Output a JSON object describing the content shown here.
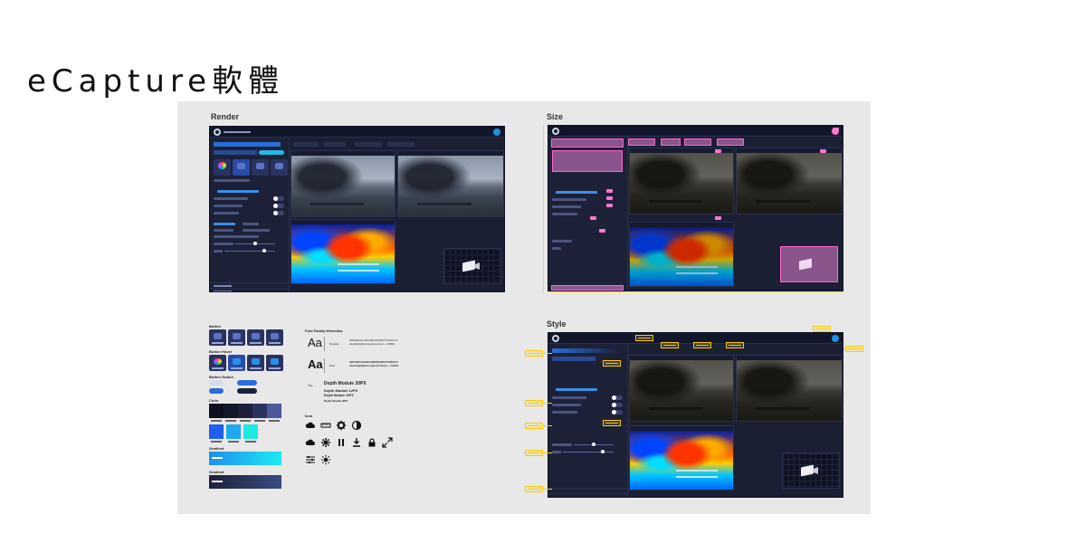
{
  "page": {
    "title": "eCapture軟體"
  },
  "sections": {
    "render": "Render",
    "size": "Size",
    "style": "Style"
  },
  "style_guide": {
    "button_label": "Button",
    "button_hover_label": "Button Hover",
    "button_switch_label": "Button Switch",
    "color_label": "Color",
    "gradient_label": "Gradient",
    "gradient_label_2": "Gradient",
    "font_family": "Font Family:Helvetica",
    "font_aa": "Aa",
    "font_sample_1_weight": "Regular",
    "font_sample_2_weight": "Bold",
    "font_alphabet": "ABCDEFGHIJKLMNOPQRSTUVWXYZ abcdefghijklmnopqrstuvwxyz +-%#$%",
    "type_title_prefix": "Title",
    "type_title": "Depth Module 20PX",
    "type_line_2": "Depth Module 12PX",
    "type_line_3": "Depth Module 10PX",
    "type_line_4": "Depth Module 8PX",
    "icon_label": "Icon",
    "colors": [
      "#0b0f1e",
      "#13172a",
      "#1c2138",
      "#2a3360",
      "#4a5a9a"
    ],
    "accent_colors": [
      "#1e5ef0",
      "#1ea8f0",
      "#1ee8e0"
    ],
    "gradient_1": [
      "#1e8ef0",
      "#1ee8f0"
    ],
    "gradient_2": [
      "#1c2138",
      "#3a4a80"
    ]
  },
  "icons": [
    "cloud-icon",
    "ruler-icon",
    "gear-icon",
    "contrast-icon",
    "cloud-icon",
    "settings-icon",
    "pause-icon",
    "download-icon",
    "lock-icon",
    "expand-icon",
    "sliders-icon",
    "brightness-icon"
  ]
}
